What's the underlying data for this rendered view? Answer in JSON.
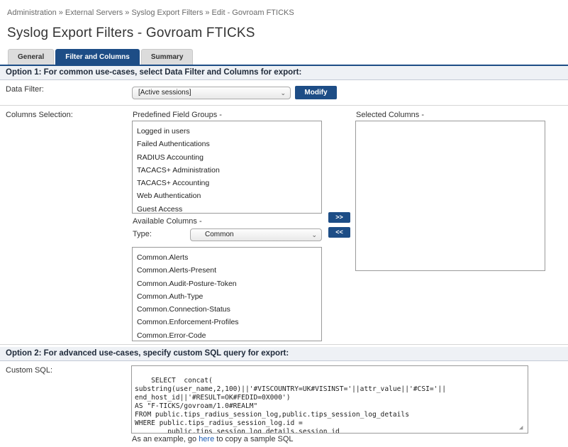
{
  "breadcrumb": "Administration » External Servers » Syslog Export Filters » Edit - Govroam FTICKS",
  "page_title": "Syslog Export Filters - Govroam FTICKS",
  "tabs": [
    {
      "label": "General"
    },
    {
      "label": "Filter and Columns"
    },
    {
      "label": "Summary"
    }
  ],
  "option1": {
    "heading": "Option 1: For common use-cases, select Data Filter and Columns for export:",
    "data_filter_label": "Data Filter:",
    "data_filter_value": "[Active sessions]",
    "modify_label": "Modify",
    "columns_label": "Columns Selection:",
    "predefined_label": "Predefined Field Groups -",
    "predefined_items": [
      "Logged in users",
      "Failed Authentications",
      "RADIUS Accounting",
      "TACACS+ Administration",
      "TACACS+ Accounting",
      "Web Authentication",
      "Guest Access"
    ],
    "available_label": "Available Columns -",
    "type_label": "Type:",
    "type_value": "Common",
    "available_items": [
      "Common.Alerts",
      "Common.Alerts-Present",
      "Common.Audit-Posture-Token",
      "Common.Auth-Type",
      "Common.Connection-Status",
      "Common.Enforcement-Profiles",
      "Common.Error-Code"
    ],
    "add_label": ">>",
    "remove_label": "<<",
    "selected_label": "Selected Columns -"
  },
  "option2": {
    "heading": "Option 2: For advanced use-cases, specify custom SQL query for export:",
    "custom_sql_label": "Custom SQL:",
    "sql_text": "SELECT  concat(\nsubstring(user_name,2,100)||'#VISCOUNTRY=UK#VISINST='||attr_value||'#CSI='||\nend_host_id||'#RESULT=OK#FEDID=0X000')\nAS \"F-TICKS/govroam/1.0#REALM\"\nFROM public.tips_radius_session_log,public.tips_session_log_details\nWHERE public.tips_radius_session_log.id =\n        public.tips_session_log_details.session_id",
    "hint_prefix": "As an example, go",
    "hint_link": "here",
    "hint_suffix": "to copy a sample SQL"
  }
}
